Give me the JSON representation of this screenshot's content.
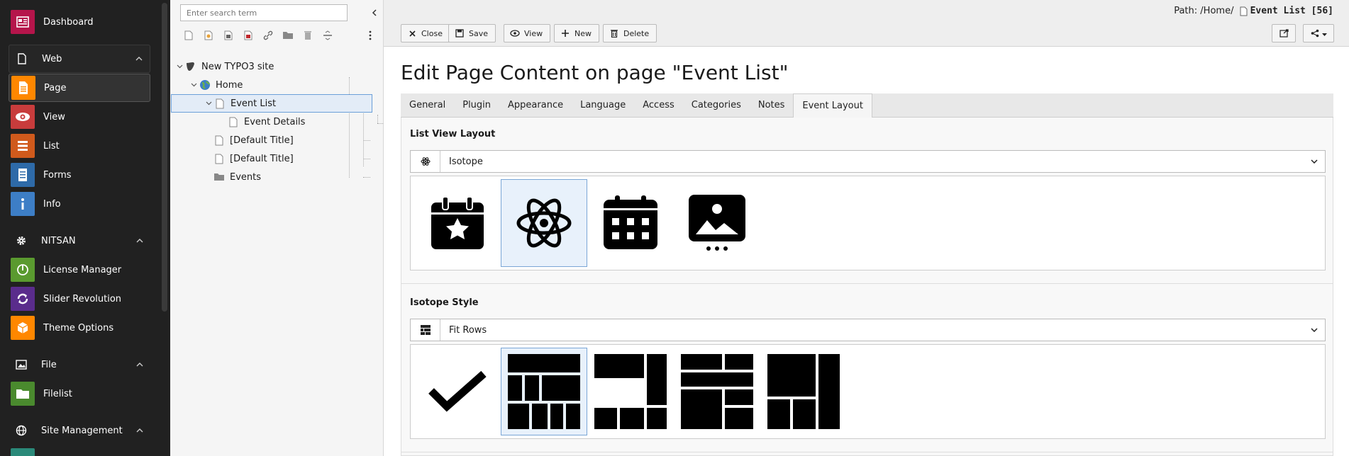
{
  "module_menu": {
    "dashboard": "Dashboard",
    "web": {
      "label": "Web",
      "items": [
        "Page",
        "View",
        "List",
        "Forms",
        "Info"
      ]
    },
    "nitsan": {
      "label": "NITSAN",
      "items": [
        "License Manager",
        "Slider Revolution",
        "Theme Options"
      ]
    },
    "file": {
      "label": "File",
      "items": [
        "Filelist"
      ]
    },
    "site_management": {
      "label": "Site Management"
    },
    "colors": {
      "dashboard": "#b5154b",
      "page": "#ff8700",
      "view": "#c83c3c",
      "list": "#d05a1c",
      "forms": "#2e6aa8",
      "info": "#3d7ec6",
      "license": "#5a9a2f",
      "slider": "#5a2c8c",
      "theme": "#ff8700",
      "filelist": "#4a8a2e"
    }
  },
  "page_tree": {
    "search_placeholder": "Enter search term",
    "nodes": {
      "root": "New TYPO3 site",
      "home": "Home",
      "event_list": "Event List",
      "event_details": "Event Details",
      "default1": "[Default Title]",
      "default2": "[Default Title]",
      "events": "Events"
    }
  },
  "docheader": {
    "path_label": "Path:",
    "path": "/Home/",
    "current": "Event List [56]",
    "buttons": {
      "close": "Close",
      "save": "Save",
      "view": "View",
      "new": "New",
      "delete": "Delete"
    }
  },
  "editor": {
    "title": "Edit Page Content on page \"Event List\"",
    "tabs": [
      "General",
      "Plugin",
      "Appearance",
      "Language",
      "Access",
      "Categories",
      "Notes",
      "Event Layout"
    ],
    "active_tab": "Event Layout",
    "list_view_layout": {
      "label": "List View Layout",
      "value": "Isotope",
      "options": [
        "calendar-star-icon",
        "atom-icon",
        "calendar-grid-icon",
        "image-gallery-icon"
      ],
      "selected": "atom-icon"
    },
    "isotope_style": {
      "label": "Isotope Style",
      "value": "Fit Rows",
      "options": [
        "check-icon",
        "fit-rows-icon",
        "masonry-icon",
        "cells-by-row-icon",
        "masonry-horizontal-icon"
      ],
      "selected": "fit-rows-icon"
    }
  }
}
